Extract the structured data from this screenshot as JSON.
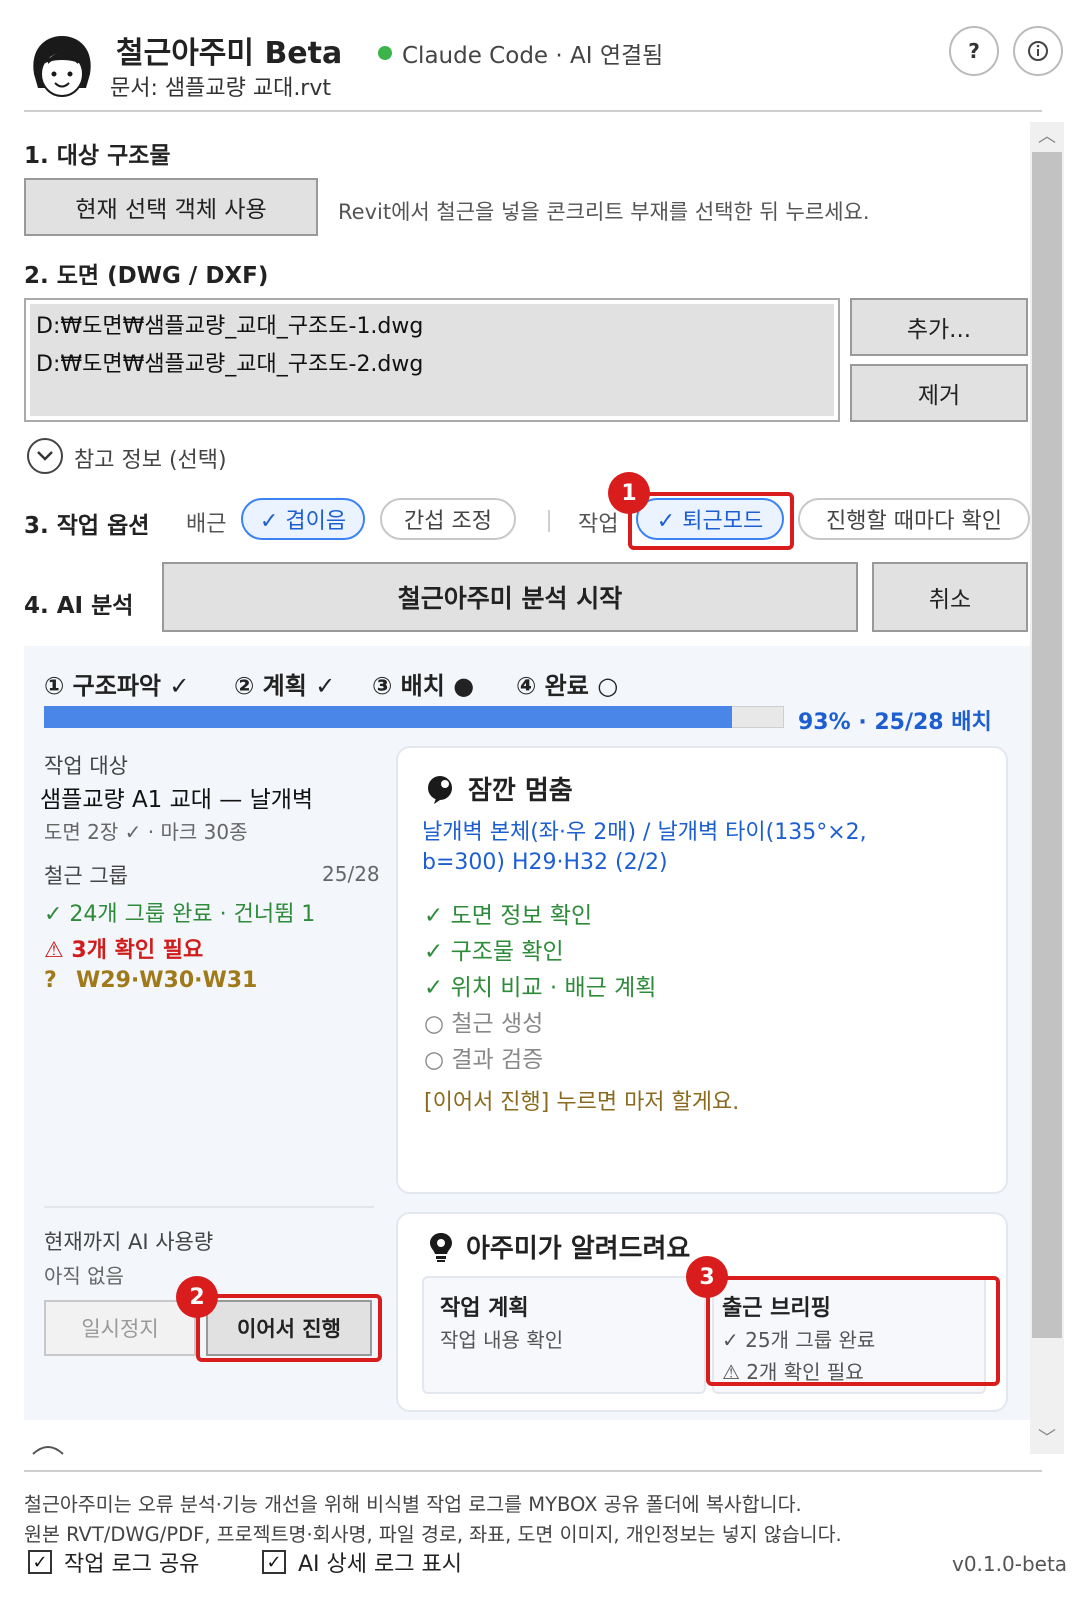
{
  "header": {
    "title": "철근아주미 Beta",
    "status": "Claude Code · AI 연결됨",
    "status_color": "#3bb54a",
    "document": "문서: 샘플교량 교대.rvt",
    "help_label": "?",
    "info_label": "ⓘ"
  },
  "section1": {
    "label": "1. 대상 구조물",
    "button": "현재 선택 객체 사용",
    "hint": "Revit에서 철근을 넣을 콘크리트 부재를 선택한 뒤 누르세요."
  },
  "section2": {
    "label": "2. 도면 (DWG / DXF)",
    "files": [
      "D:₩도면₩샘플교량_교대_구조도-1.dwg",
      "D:₩도면₩샘플교량_교대_구조도-2.dwg"
    ],
    "add_button": "추가...",
    "remove_button": "제거",
    "reference": "참고 정보 (선택)"
  },
  "section3": {
    "label": "3. 작업 옵션",
    "rebar_label": "배근",
    "lap_option": "✓ 겹이음",
    "interference_option": "간섭 조정",
    "work_label": "작업",
    "auto_mode": "✓ 퇴근모드",
    "confirm_mode": "진행할 때마다 확인"
  },
  "section4": {
    "label": "4. AI 분석",
    "start_button": "철근아주미 분석 시작",
    "cancel_button": "취소"
  },
  "progress": {
    "steps": [
      "① 구조파악 ✓",
      "② 계획 ✓",
      "③ 배치 ●",
      "④ 완료 ○"
    ],
    "percent": 93,
    "text": "93%  ·  25/28 배치",
    "bar_color": "#4a86e8"
  },
  "work": {
    "target_label": "작업 대상",
    "target_name": "샘플교량 A1 교대 — 날개벽",
    "target_sub": "도면 2장 ✓ · 마크 30종",
    "group_label": "철근 그룹",
    "group_count": "25/28",
    "done_line": "✓  24개 그룹 완료 · 건너뜀 1",
    "warn_line": "⚠ 3개 확인 필요",
    "q_mark": "?",
    "q_items": "W29·W30·W31",
    "usage_label": "현재까지 AI 사용량",
    "usage_value": "아직 없음",
    "pause_button": "일시정지",
    "continue_button": "이어서 진행"
  },
  "pause_card": {
    "title": "잠깐 멈춤",
    "target_line1": "날개벽 본체(좌·우 2매) / 날개벽 타이(135°×2,",
    "target_line2": "b=300) H29·H32 (2/2)",
    "checks_done": [
      "✓   도면 정보 확인",
      "✓   구조물 확인",
      "✓   위치 비교 · 배근 계획"
    ],
    "checks_pending": [
      "○   철근 생성",
      "○   결과 검증"
    ],
    "note": "[이어서 진행] 누르면 마저 할게요."
  },
  "tips_card": {
    "title": "아주미가 알려드려요",
    "plan_title": "작업 계획",
    "plan_sub": "작업 내용 확인",
    "brief_title": "출근 브리핑",
    "brief_line1": "✓ 25개 그룹 완료",
    "brief_line2": "⚠ 2개 확인 필요"
  },
  "callouts": [
    "1",
    "2",
    "3"
  ],
  "footer": {
    "line1": "철근아주미는 오류 분석·기능 개선을 위해 비식별 작업 로그를 MYBOX 공유 폴더에 복사합니다.",
    "line2": "원본 RVT/DWG/PDF, 프로젝트명·회사명, 파일 경로, 좌표, 도면 이미지, 개인정보는 넣지 않습니다.",
    "share_log": "작업 로그 공유",
    "ai_log": "AI 상세 로그 표시",
    "check_mark": "✓",
    "version": "v0.1.0-beta"
  }
}
